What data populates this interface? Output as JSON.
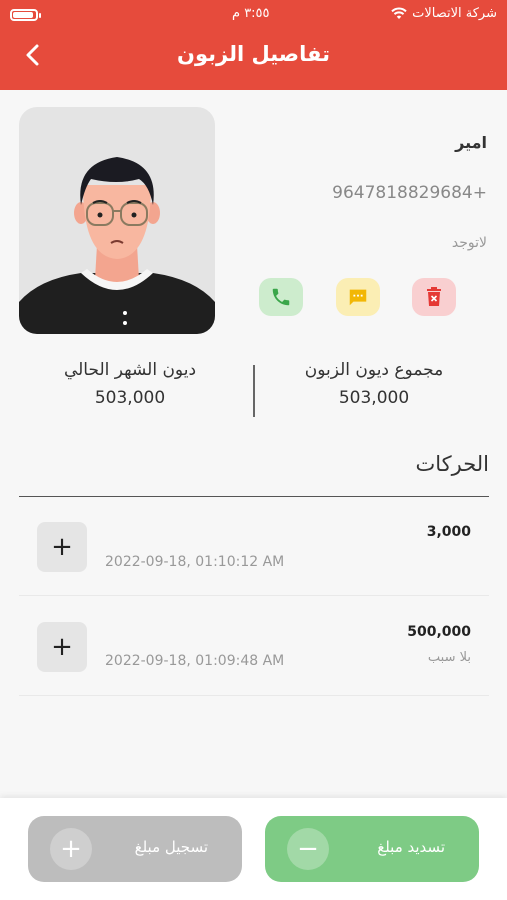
{
  "status_bar": {
    "carrier": "شركة الاتصالات",
    "time": "٣:٥٥ م"
  },
  "header": {
    "title": "تفاصيل الزبون",
    "back_icon": "chevron-left-icon"
  },
  "customer": {
    "name": "امير",
    "phone": "9647818829684+",
    "note": "لاتوجد",
    "actions": [
      "phone-icon",
      "message-icon",
      "delete-icon"
    ]
  },
  "stats": {
    "current_month_label": "ديون الشهر الحالي",
    "current_month_value": "503,000",
    "total_label": "مجموع ديون الزبون",
    "total_value": "503,000"
  },
  "transactions": {
    "section_title": "الحركات",
    "items": [
      {
        "amount": "3,000",
        "reason": "",
        "date": "2022-09-18, 01:10:12 AM"
      },
      {
        "amount": "500,000",
        "reason": "بلا سبب",
        "date": "2022-09-18, 01:09:48 AM"
      }
    ]
  },
  "bottom_bar": {
    "pay_label": "تسديد مبلغ",
    "record_label": "تسجيل مبلغ"
  },
  "colors": {
    "header": "#e64b3c",
    "pay_button": "#7ecb85",
    "record_button": "#bdbdbd"
  }
}
